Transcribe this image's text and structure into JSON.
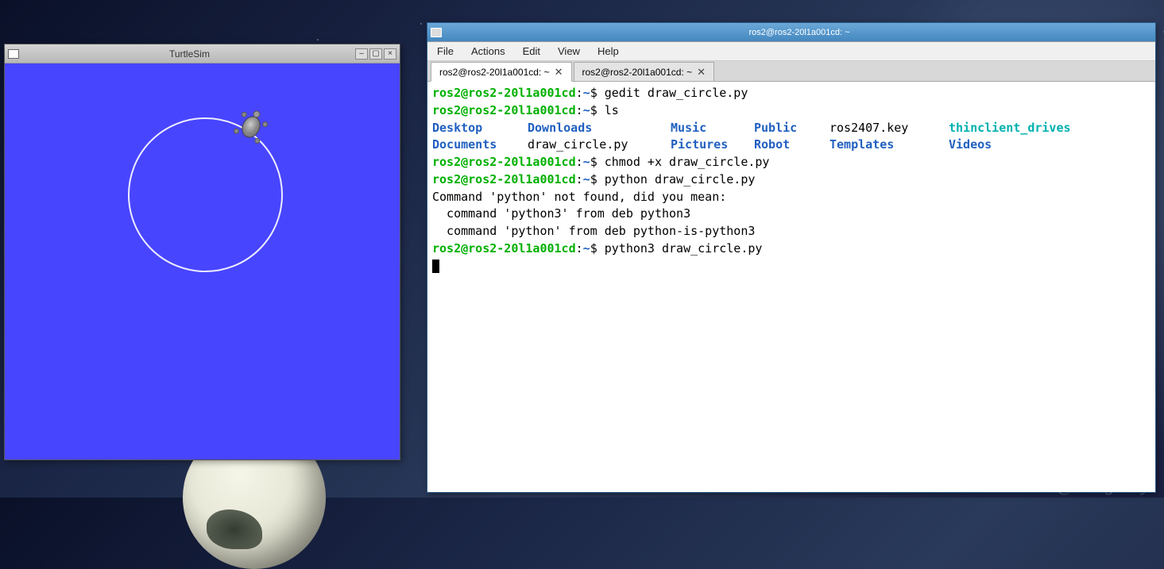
{
  "watermark": "CSDN @zhangrelay",
  "turtlesim": {
    "title": "TurtleSim"
  },
  "terminal": {
    "title": "ros2@ros2-20l1a001cd: ~",
    "menubar": [
      "File",
      "Actions",
      "Edit",
      "View",
      "Help"
    ],
    "tabs": [
      {
        "label": "ros2@ros2-20l1a001cd: ~",
        "active": true
      },
      {
        "label": "ros2@ros2-20l1a001cd: ~",
        "active": false
      }
    ],
    "prompt_user": "ros2@ros2-20l1a001cd",
    "prompt_sep": ":",
    "prompt_path": "~",
    "prompt_suffix": "$ ",
    "lines": {
      "cmd1": "gedit draw_circle.py",
      "cmd2": "ls",
      "cmd3": "chmod +x draw_circle.py",
      "cmd4": "python draw_circle.py",
      "cmd5": "python3 draw_circle.py",
      "err1": "Command 'python' not found, did you mean:",
      "err2": "  command 'python3' from deb python3",
      "err3": "  command 'python' from deb python-is-python3"
    },
    "ls_output": {
      "row1": [
        {
          "text": "Desktop",
          "class": "dir-b"
        },
        {
          "text": "Downloads",
          "class": "dir-b"
        },
        {
          "text": "Music",
          "class": "dir-b"
        },
        {
          "text": "Public",
          "class": "dir-b"
        },
        {
          "text": "ros2407.key",
          "class": ""
        },
        {
          "text": "thinclient_drives",
          "class": "dir-c"
        }
      ],
      "row2": [
        {
          "text": "Documents",
          "class": "dir-b"
        },
        {
          "text": "draw_circle.py",
          "class": ""
        },
        {
          "text": "Pictures",
          "class": "dir-b"
        },
        {
          "text": "Robot",
          "class": "dir-b"
        },
        {
          "text": "Templates",
          "class": "dir-b"
        },
        {
          "text": "Videos",
          "class": "dir-b"
        }
      ]
    }
  }
}
